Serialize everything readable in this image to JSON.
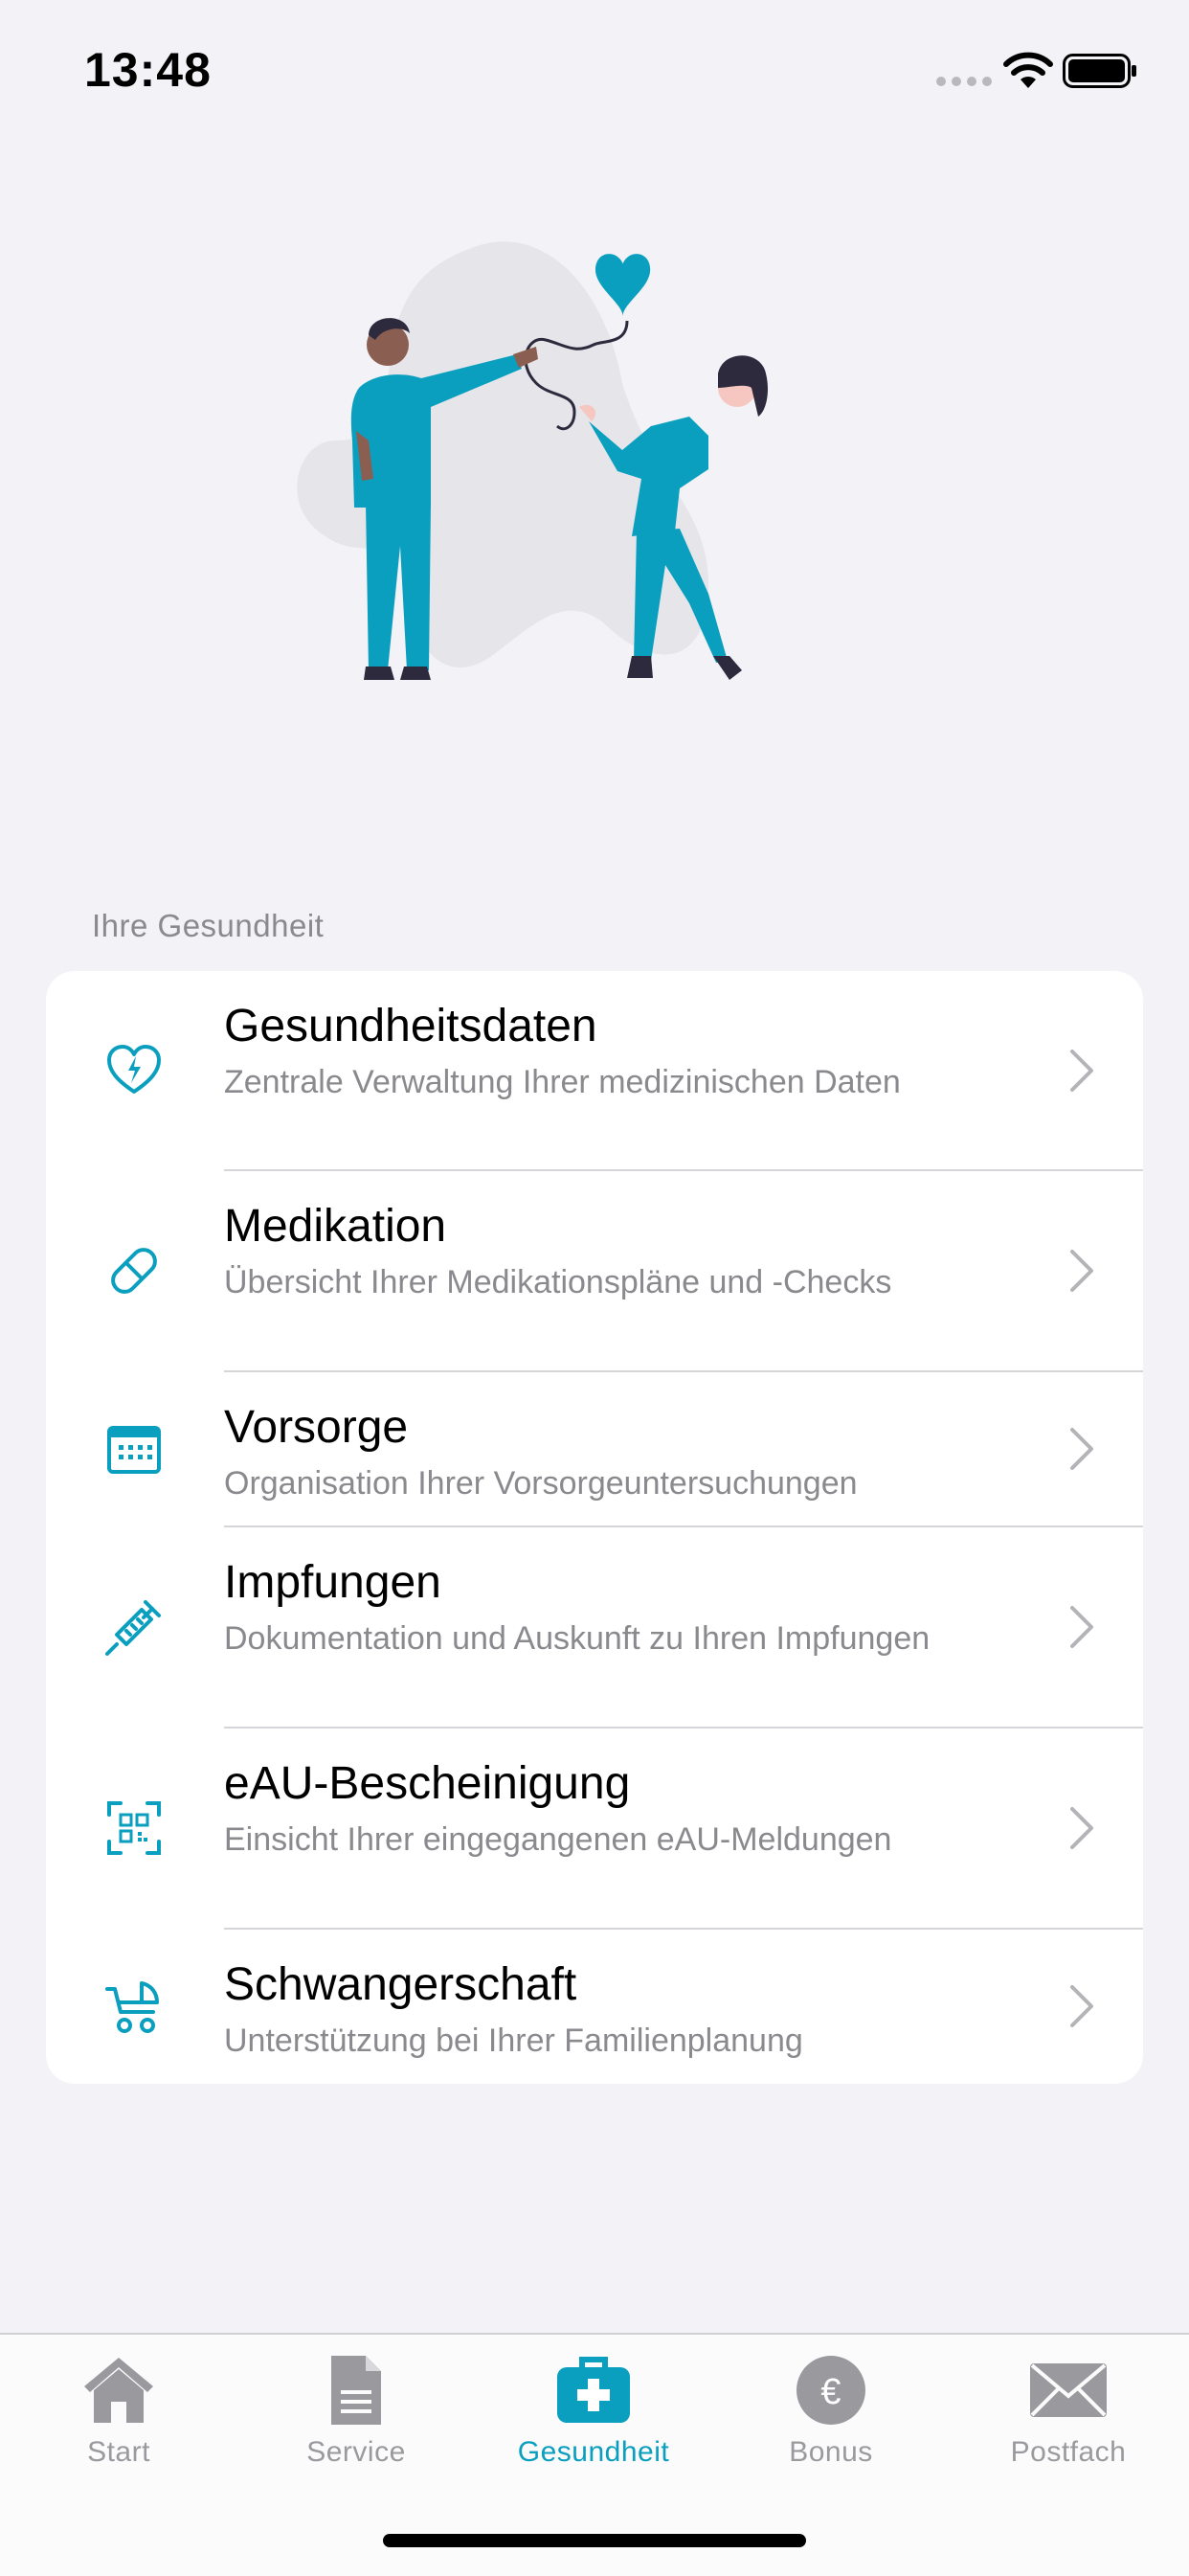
{
  "status": {
    "time": "13:48"
  },
  "section": {
    "header": "Ihre Gesundheit"
  },
  "colors": {
    "accent": "#0a9fbf",
    "inactive": "#9a9a9e",
    "background": "#f2f2f7"
  },
  "items": [
    {
      "icon": "heart-pulse-icon",
      "title": "Gesundheitsdaten",
      "subtitle": "Zentrale Verwaltung Ihrer medizinischen Daten"
    },
    {
      "icon": "pill-icon",
      "title": "Medikation",
      "subtitle": "Übersicht Ihrer Medikationspläne und -Checks"
    },
    {
      "icon": "calendar-icon",
      "title": "Vorsorge",
      "subtitle": "Organisation Ihrer Vorsorgeuntersuchungen"
    },
    {
      "icon": "syringe-icon",
      "title": "Impfungen",
      "subtitle": "Dokumentation und Auskunft zu Ihren Impfungen"
    },
    {
      "icon": "qr-scan-icon",
      "title": "eAU-Bescheinigung",
      "subtitle": "Einsicht Ihrer eingegangenen eAU-Meldungen"
    },
    {
      "icon": "stroller-icon",
      "title": "Schwangerschaft",
      "subtitle": "Unterstützung bei Ihrer Familienplanung"
    }
  ],
  "tabs": [
    {
      "label": "Start",
      "icon": "house-icon",
      "active": false
    },
    {
      "label": "Service",
      "icon": "document-icon",
      "active": false
    },
    {
      "label": "Gesundheit",
      "icon": "medical-case-icon",
      "active": true
    },
    {
      "label": "Bonus",
      "icon": "euro-coin-icon",
      "active": false
    },
    {
      "label": "Postfach",
      "icon": "envelope-icon",
      "active": false
    }
  ]
}
